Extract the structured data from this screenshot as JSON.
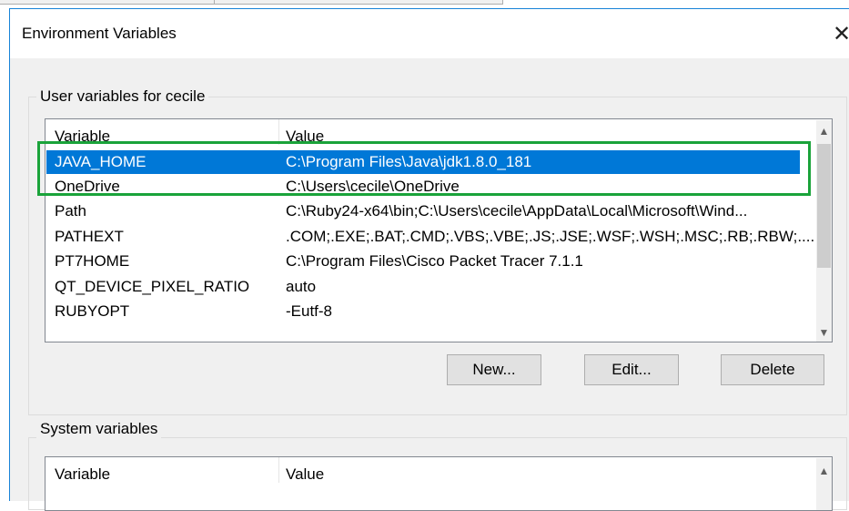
{
  "dialog": {
    "title": "Environment Variables",
    "close_icon": "close-icon"
  },
  "user_vars": {
    "group_label": "User variables for cecile",
    "columns": [
      "Variable",
      "Value"
    ],
    "rows": [
      {
        "variable": "JAVA_HOME",
        "value": "C:\\Program Files\\Java\\jdk1.8.0_181",
        "selected": true
      },
      {
        "variable": "OneDrive",
        "value": "C:\\Users\\cecile\\OneDrive"
      },
      {
        "variable": "Path",
        "value": "C:\\Ruby24-x64\\bin;C:\\Users\\cecile\\AppData\\Local\\Microsoft\\Wind..."
      },
      {
        "variable": "PATHEXT",
        "value": ".COM;.EXE;.BAT;.CMD;.VBS;.VBE;.JS;.JSE;.WSF;.WSH;.MSC;.RB;.RBW;...."
      },
      {
        "variable": "PT7HOME",
        "value": "C:\\Program Files\\Cisco Packet Tracer 7.1.1"
      },
      {
        "variable": "QT_DEVICE_PIXEL_RATIO",
        "value": "auto"
      },
      {
        "variable": "RUBYOPT",
        "value": "-Eutf-8"
      }
    ],
    "buttons": {
      "new": "New...",
      "edit": "Edit...",
      "delete": "Delete"
    }
  },
  "system_vars": {
    "group_label": "System variables",
    "columns": [
      "Variable",
      "Value"
    ]
  },
  "colors": {
    "selection": "#0078d7",
    "highlight_box": "#1aa33a",
    "window_border": "#1883d7"
  }
}
